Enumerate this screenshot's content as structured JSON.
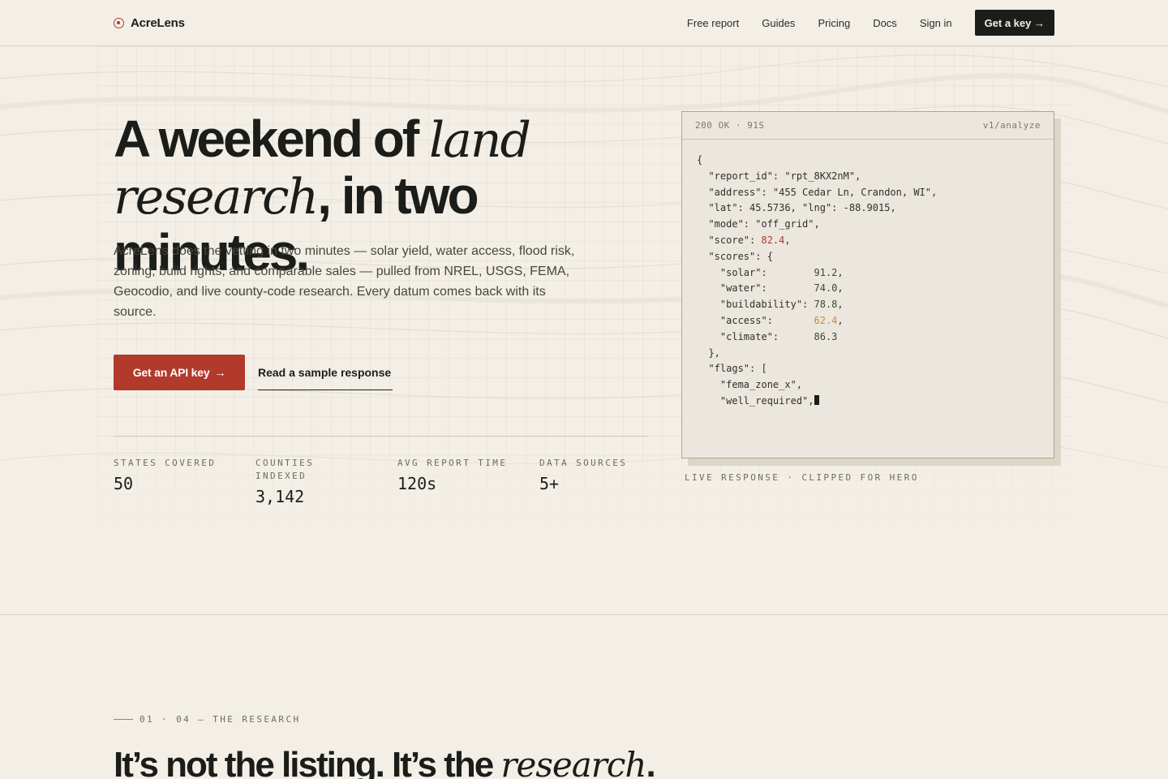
{
  "brand": {
    "name": "AcreLens",
    "icon": "crosshair-icon",
    "accent": "#b23a2b"
  },
  "nav": {
    "links": [
      "Free report",
      "Guides",
      "Pricing",
      "Docs",
      "Sign in"
    ],
    "cta": "Get a key →"
  },
  "hero": {
    "headline_a": "A weekend of ",
    "headline_em1": "land research",
    "headline_b": ", in two minutes.",
    "lede": "AcreLens does the vetting in two minutes — solar yield, water access, flood risk, zoning, build rights, and comparable sales — pulled from NREL, USGS, FEMA, Geocodio, and live county-code research. Every datum comes back with its source.",
    "primary_cta": "Get an API key",
    "primary_cta_arrow": "→",
    "secondary_cta": "Read a sample response"
  },
  "stats": [
    {
      "label": "STATES COVERED",
      "value": "50"
    },
    {
      "label": "COUNTIES INDEXED",
      "value": "3,142"
    },
    {
      "label": "AVG REPORT TIME",
      "value": "120s"
    },
    {
      "label": "DATA SOURCES",
      "value": "5+"
    }
  ],
  "response_card": {
    "status": "200 OK · 91S",
    "endpoint": "v1/analyze",
    "report_id": "rpt_8KX2nM",
    "address": "455 Cedar Ln, Crandon, WI",
    "lat": "45.5736",
    "lng": "-88.9015",
    "mode": "off_grid",
    "score": "82.4",
    "scores": {
      "solar": "91.2",
      "water": "74.0",
      "buildability": "78.8",
      "access": "62.4",
      "climate": "86.3"
    },
    "flags": [
      "fema_zone_x",
      "well_required"
    ],
    "caption": "LIVE RESPONSE · CLIPPED FOR HERO"
  },
  "section": {
    "eyebrow": "01 · 04 — THE RESEARCH",
    "title_a": "It’s not the listing. It’s the ",
    "title_em": "research",
    "title_b": "."
  }
}
